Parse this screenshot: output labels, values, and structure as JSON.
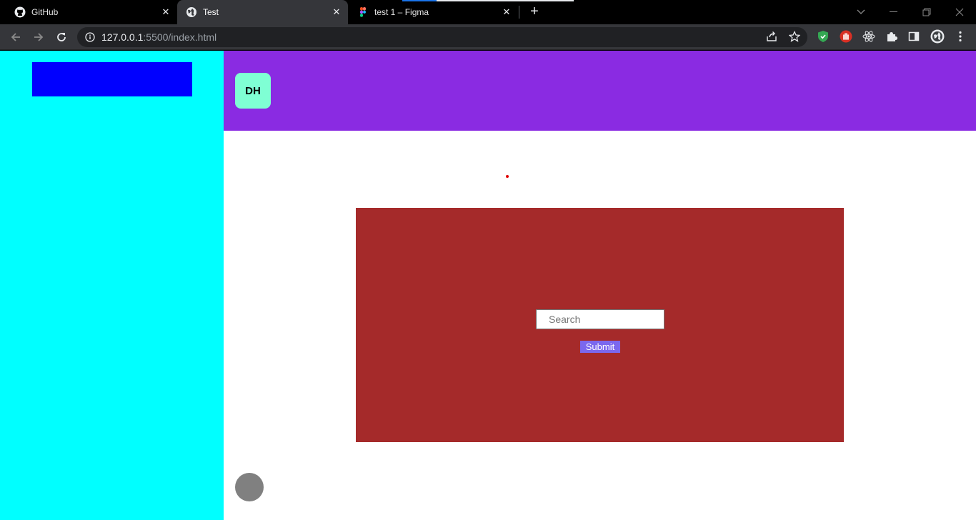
{
  "browser": {
    "tabs": [
      {
        "title": "GitHub",
        "icon": "github-icon",
        "active": false
      },
      {
        "title": "Test",
        "icon": "globe-icon",
        "active": true
      },
      {
        "title": "test 1 – Figma",
        "icon": "figma-icon",
        "active": false
      }
    ],
    "new_tab_symbol": "+",
    "url_host": "127.0.0.1",
    "url_rest": ":5500/index.html",
    "close_symbol": "✕"
  },
  "page": {
    "avatar_initials": "DH",
    "search_placeholder": "Search",
    "submit_label": "Submit"
  },
  "colors": {
    "sidebar": "#00ffff",
    "sidebar_block": "#0000ff",
    "header": "#8a2be2",
    "avatar": "#7fffd4",
    "panel": "#a52a2a",
    "submit": "#7b68ee",
    "circle": "#808080"
  }
}
